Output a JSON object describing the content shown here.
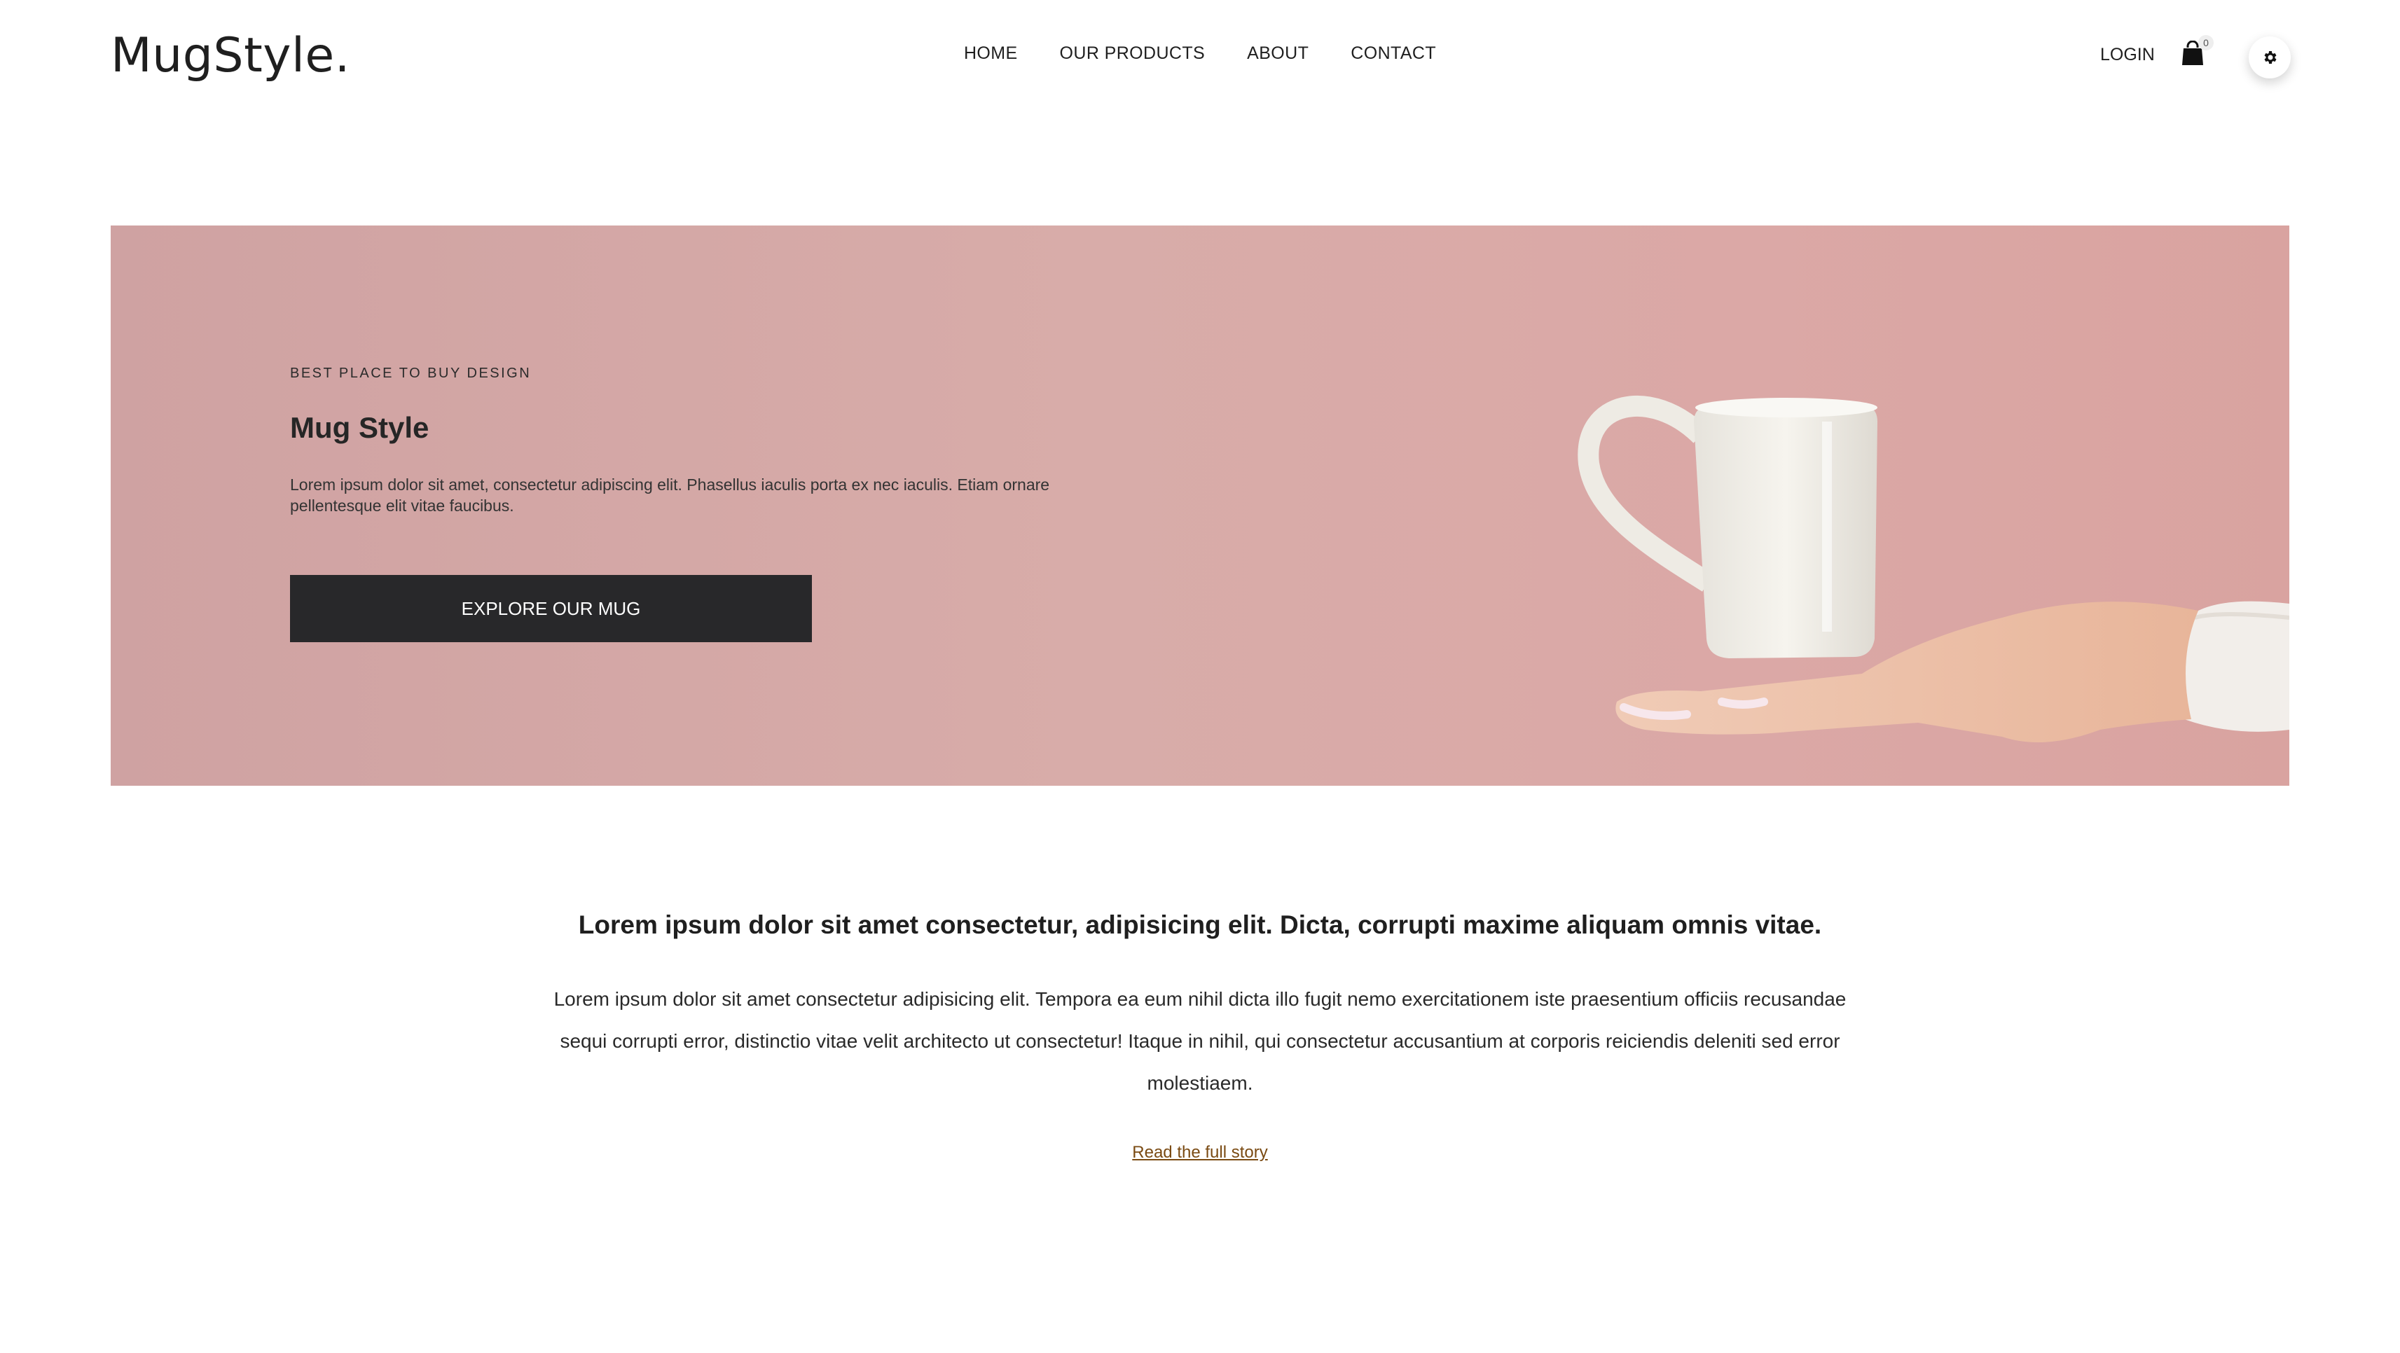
{
  "header": {
    "logo": "MugStyle.",
    "nav": [
      "HOME",
      "OUR PRODUCTS",
      "ABOUT",
      "CONTACT"
    ],
    "login_label": "LOGIN",
    "cart_count": "0",
    "cart_icon": "shopping-bag-icon",
    "settings_icon": "gear-icon"
  },
  "hero": {
    "eyebrow": "BEST PLACE TO BUY DESIGN",
    "title": "Mug Style",
    "text": "Lorem ipsum dolor sit amet, consectetur adipiscing elit. Phasellus iaculis porta ex nec iaculis. Etiam ornare pellentesque elit vitae faucibus.",
    "cta_label": "EXPLORE OUR MUG",
    "background_color": "#d8aca9"
  },
  "story": {
    "heading": "Lorem ipsum dolor sit amet consectetur, adipisicing elit. Dicta, corrupti maxime aliquam omnis vitae.",
    "body": "Lorem ipsum dolor sit amet consectetur adipisicing elit. Tempora ea eum nihil dicta illo fugit nemo exercitationem iste praesentium officiis recusandae sequi corrupti error, distinctio vitae velit architecto ut consectetur! Itaque in nihil, qui consectetur accusantium at corporis reiciendis deleniti sed error molestiaem.",
    "link_label": "Read the full story"
  }
}
